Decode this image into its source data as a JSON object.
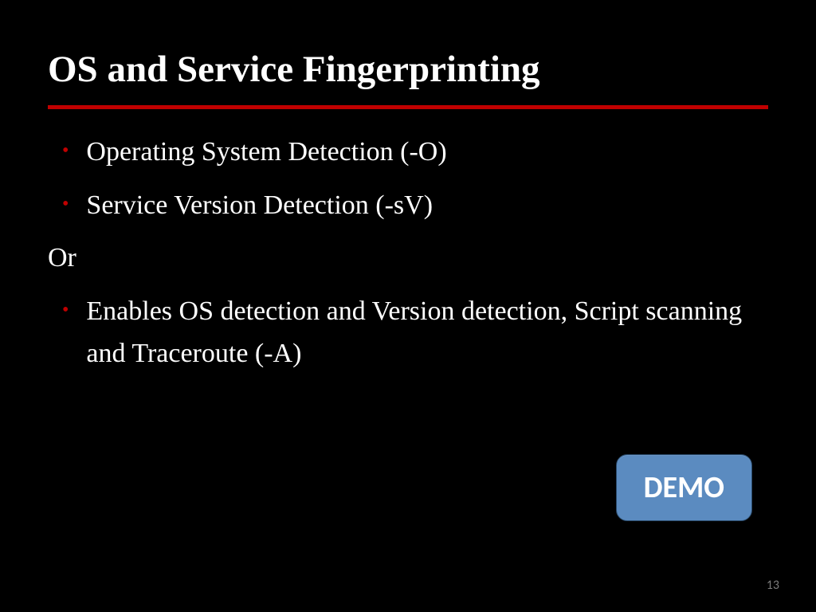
{
  "slide": {
    "title": "OS and Service Fingerprinting",
    "bullets": {
      "item1": "Operating System Detection (-O)",
      "item2": "Service Version Detection (-sV)",
      "or_label": "Or",
      "item3": "Enables OS detection and Version detection, Script scanning and Traceroute (-A)"
    },
    "demo_label": "DEMO",
    "page_number": "13",
    "accent_color": "#c00000",
    "button_color": "#5b8bc0"
  }
}
